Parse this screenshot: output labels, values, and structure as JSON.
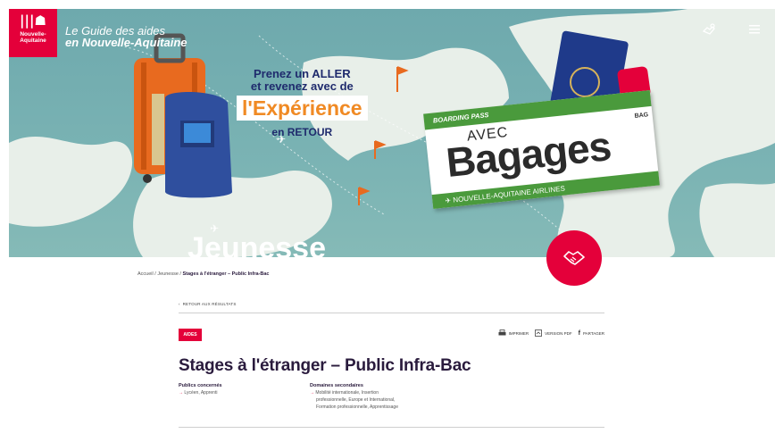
{
  "colors": {
    "brand_red": "#e4003a",
    "map_sea": "#79b2b3",
    "green": "#4a9a3c",
    "orange": "#f08a24",
    "navy": "#2a1b3d"
  },
  "header": {
    "logo_text": "Nouvelle-Aquitaine",
    "guide_line1": "Le Guide des aides",
    "guide_line2": "en Nouvelle-Aquitaine",
    "icons": [
      "handshake-icon",
      "menu-icon"
    ]
  },
  "hero": {
    "tagline_line1": "Prenez un ALLER",
    "tagline_line2": "et revenez avec de",
    "tagline_big": "l'Expérience",
    "tagline_line3": "en RETOUR",
    "pass_header": "BOARDING PASS",
    "pass_avec": "AVEC",
    "pass_title": "Bagages",
    "pass_airline": "NOUVELLE-AQUITAINE AIRLINES",
    "pass_code": "BAG",
    "section_title": "Jeunesse"
  },
  "breadcrumb": {
    "home": "Accueil",
    "sep": "/",
    "section": "Jeunesse",
    "current": "Stages à l'étranger – Public Infra-Bac"
  },
  "back_link": "RETOUR AUX RÉSULTATS",
  "tag": "AIDES",
  "actions": {
    "print": "IMPRIMER",
    "pdf": "VERSION PDF",
    "share": "PARTAGER"
  },
  "title": "Stages à l'étranger – Public Infra-Bac",
  "publics": {
    "label": "Publics concernés",
    "value": "Lycéen, Apprenti"
  },
  "domaines": {
    "label": "Domaines secondaires",
    "lines": [
      "Mobilité internationale, Insertion",
      "professionnelle, Europe et International,",
      "Formation professionnelle, Apprentissage"
    ]
  }
}
